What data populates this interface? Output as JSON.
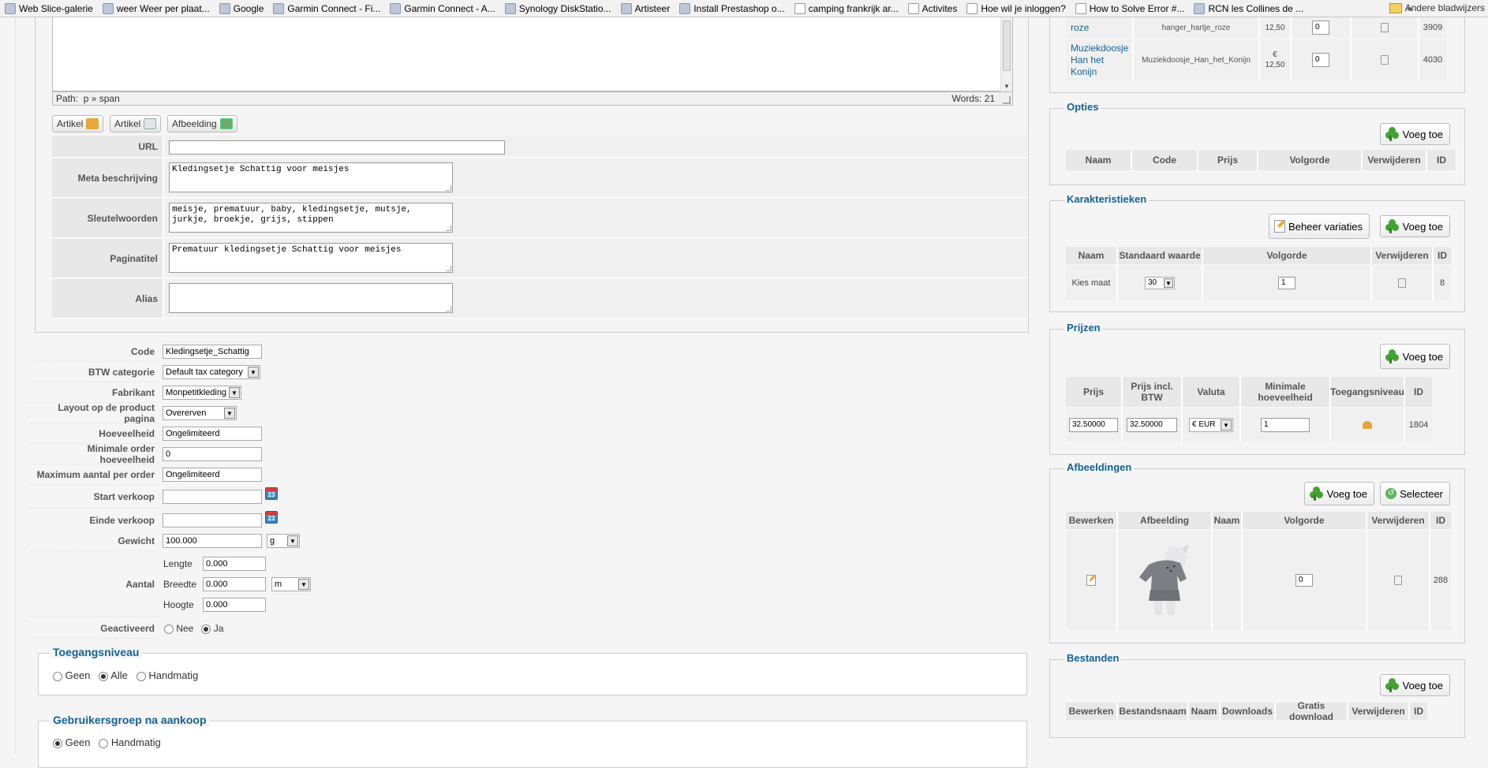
{
  "bookmarks": [
    {
      "label": "Web Slice-galerie",
      "icon": "ie-icon"
    },
    {
      "label": "weer Weer per plaat...",
      "icon": "weather-icon"
    },
    {
      "label": "Google",
      "icon": "google-icon"
    },
    {
      "label": "Garmin Connect - Fi...",
      "icon": "garmin-icon"
    },
    {
      "label": "Garmin Connect - A...",
      "icon": "garmin-icon"
    },
    {
      "label": "Synology DiskStatio...",
      "icon": "synology-icon"
    },
    {
      "label": "Artisteer",
      "icon": "artisteer-icon"
    },
    {
      "label": "Install Prestashop o...",
      "icon": "drupal-icon"
    },
    {
      "label": "camping frankrijk ar...",
      "icon": "doc-icon"
    },
    {
      "label": "Activites",
      "icon": "doc-icon"
    },
    {
      "label": "Hoe wil je inloggen?",
      "icon": "doc-icon"
    },
    {
      "label": "How to Solve Error #...",
      "icon": "doc-icon"
    },
    {
      "label": "RCN les Collines de ...",
      "icon": "rcn-icon"
    }
  ],
  "bookmarks_more": "»",
  "bookmarks_other": "Andere bladwijzers",
  "editor": {
    "path_label": "Path:",
    "path_value": "p » span",
    "words": "Words: 21",
    "buttons": [
      "Artikel",
      "Artikel",
      "Afbeelding"
    ]
  },
  "meta": {
    "url_label": "URL",
    "url_value": "",
    "meta_desc_label": "Meta beschrijving",
    "meta_desc_value": "Kledingsetje Schattig voor meisjes",
    "keywords_label": "Sleutelwoorden",
    "keywords_value": "meisje, prematuur, baby, kledingsetje, mutsje, jurkje, broekje, grijs, stippen",
    "title_label": "Paginatitel",
    "title_value": "Prematuur kledingsetje Schattig voor meisjes",
    "alias_label": "Alias",
    "alias_value": ""
  },
  "fields": {
    "code_label": "Code",
    "code_value": "Kledingsetje_Schattig",
    "btw_label": "BTW categorie",
    "btw_value": "Default tax category",
    "fabrikant_label": "Fabrikant",
    "fabrikant_value": "Monpetitkleding",
    "layout_label": "Layout op de product pagina",
    "layout_value": "Overerven",
    "hoeveelheid_label": "Hoeveelheid",
    "hoeveelheid_value": "Ongelimiteerd",
    "min_order_label": "Minimale order hoeveelheid",
    "min_order_value": "0",
    "max_order_label": "Maximum aantal per order",
    "max_order_value": "Ongelimiteerd",
    "start_label": "Start verkoop",
    "start_value": "",
    "einde_label": "Einde verkoop",
    "einde_value": "",
    "calendar_glyph": "23",
    "gewicht_label": "Gewicht",
    "gewicht_value": "100.000",
    "gewicht_unit": "g",
    "aantal_label": "Aantal",
    "lengte_label": "Lengte",
    "lengte_value": "0.000",
    "breedte_label": "Breedte",
    "breedte_value": "0.000",
    "dim_unit": "m",
    "hoogte_label": "Hoogte",
    "hoogte_value": "0.000",
    "geactiveerd_label": "Geactiveerd",
    "nee_label": "Nee",
    "ja_label": "Ja"
  },
  "toegang": {
    "legend": "Toegangsniveau",
    "opts": [
      "Geen",
      "Alle",
      "Handmatig"
    ]
  },
  "gebruikersgroep": {
    "legend": "Gebruikersgroep na aankoop",
    "opts": [
      "Geen",
      "Handmatig"
    ]
  },
  "right": {
    "top_rows": [
      {
        "name": "roze",
        "code": "hanger_hartje_roze",
        "price_sym": "€",
        "price": "12,50",
        "order": "0",
        "id": "3909"
      },
      {
        "name": "Muziekdoosje Han het Konijn",
        "code": "Muziekdoosje_Han_het_Konijn",
        "price_sym": "€",
        "price": "12,50",
        "order": "0",
        "id": "4030"
      }
    ],
    "opties": {
      "legend": "Opties",
      "add": "Voeg toe",
      "cols": [
        "Naam",
        "Code",
        "Prijs",
        "Volgorde",
        "Verwijderen",
        "ID"
      ]
    },
    "kar": {
      "legend": "Karakteristieken",
      "manage": "Beheer variaties",
      "add": "Voeg toe",
      "cols": [
        "Naam",
        "Standaard waarde",
        "Volgorde",
        "Verwijderen",
        "ID"
      ],
      "row": {
        "naam": "Kies maat",
        "std": "30",
        "volgorde": "1",
        "id": "8"
      }
    },
    "prijzen": {
      "legend": "Prijzen",
      "add": "Voeg toe",
      "cols": [
        "Prijs",
        "Prijs incl. BTW",
        "Valuta",
        "Minimale hoeveelheid",
        "Toegangsniveau",
        "ID"
      ],
      "row": {
        "prijs": "32.50000",
        "incl": "32.50000",
        "valuta": "€ EUR",
        "min": "1",
        "id": "1804"
      }
    },
    "afbeeldingen": {
      "legend": "Afbeeldingen",
      "add": "Voeg toe",
      "select": "Selecteer",
      "cols": [
        "Bewerken",
        "Afbeelding",
        "Naam",
        "Volgorde",
        "Verwijderen",
        "ID"
      ],
      "row": {
        "volgorde": "0",
        "id": "288"
      }
    },
    "bestanden": {
      "legend": "Bestanden",
      "add": "Voeg toe",
      "cols": [
        "Bewerken",
        "Bestandsnaam",
        "Naam",
        "Downloads",
        "Gratis download",
        "Verwijderen",
        "ID"
      ]
    }
  }
}
